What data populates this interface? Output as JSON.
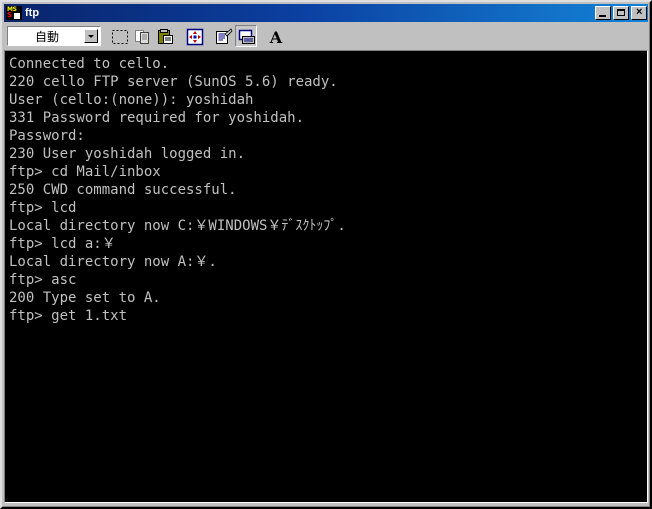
{
  "window": {
    "title": "ftp",
    "icon": "ms-dos-icon",
    "icon_text_top": "MS",
    "icon_text_bottom": "S",
    "controls": {
      "minimize": "–",
      "maximize": "□",
      "close": "×"
    }
  },
  "toolbar": {
    "font_size_selector": {
      "value": "自動",
      "options": [
        "自動"
      ]
    },
    "buttons": [
      {
        "name": "mark-button",
        "tooltip": "Mark",
        "pressed": false,
        "enabled": true
      },
      {
        "name": "copy-button",
        "tooltip": "Copy",
        "pressed": false,
        "enabled": false
      },
      {
        "name": "paste-button",
        "tooltip": "Paste",
        "pressed": false,
        "enabled": true
      },
      {
        "name": "fullscreen-button",
        "tooltip": "Full Screen",
        "pressed": false,
        "enabled": true
      },
      {
        "name": "properties-button",
        "tooltip": "Properties",
        "pressed": false,
        "enabled": true
      },
      {
        "name": "background-button",
        "tooltip": "Background",
        "pressed": true,
        "enabled": true
      },
      {
        "name": "font-button",
        "tooltip": "Font",
        "pressed": false,
        "enabled": true
      }
    ]
  },
  "console": {
    "background_color": "#000000",
    "text_color": "#c0c0c0",
    "lines": [
      "Connected to cello.",
      "220 cello FTP server (SunOS 5.6) ready.",
      "User (cello:(none)): yoshidah",
      "331 Password required for yoshidah.",
      "Password:",
      "230 User yoshidah logged in.",
      "ftp> cd Mail/inbox",
      "250 CWD command successful.",
      "ftp> lcd",
      "Local directory now C:￥WINDOWS￥ﾃﾞｽｸﾄｯﾌﾟ.",
      "ftp> lcd a:￥",
      "Local directory now A:￥.",
      "ftp> asc",
      "200 Type set to A.",
      "ftp> get 1.txt"
    ]
  }
}
